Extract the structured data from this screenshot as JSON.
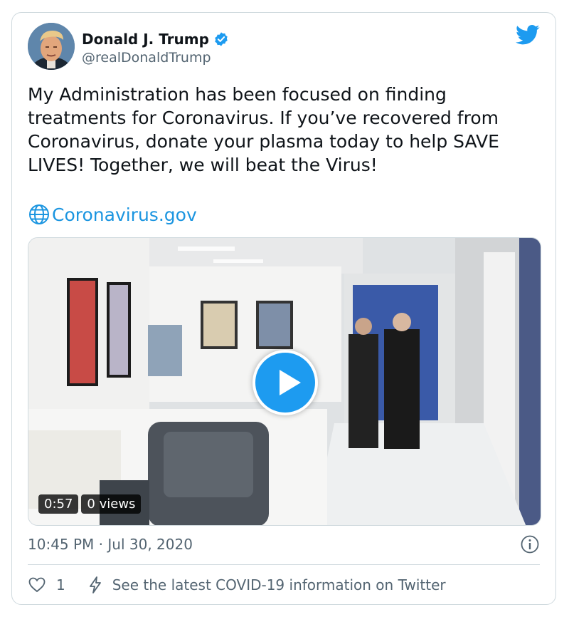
{
  "tweet": {
    "author_name": "Donald J. Trump",
    "handle": "@realDonaldTrump",
    "text_lines": [
      "My Administration has been focused on finding",
      "treatments for Coronavirus. If you’ve recovered from",
      "Coronavirus, donate your plasma today to help SAVE",
      "LIVES! Together, we will beat the Virus!"
    ],
    "link_text": "Coronavirus.gov",
    "timestamp": "10:45 PM · Jul 30, 2020",
    "like_count": "1",
    "covid_info": "See the latest COVID-19 information on Twitter"
  },
  "video": {
    "duration": "0:57",
    "views": "0 views"
  },
  "icons": {
    "verified": "verified-badge-icon",
    "brand": "twitter-bird-icon",
    "link": "globe-icon",
    "play": "play-icon",
    "info": "info-icon",
    "like": "heart-icon",
    "covid": "bolt-icon"
  },
  "colors": {
    "accent": "#1d9bf0",
    "link": "#1b95e0",
    "secondary_text": "#536471",
    "border": "#cfd9de"
  }
}
